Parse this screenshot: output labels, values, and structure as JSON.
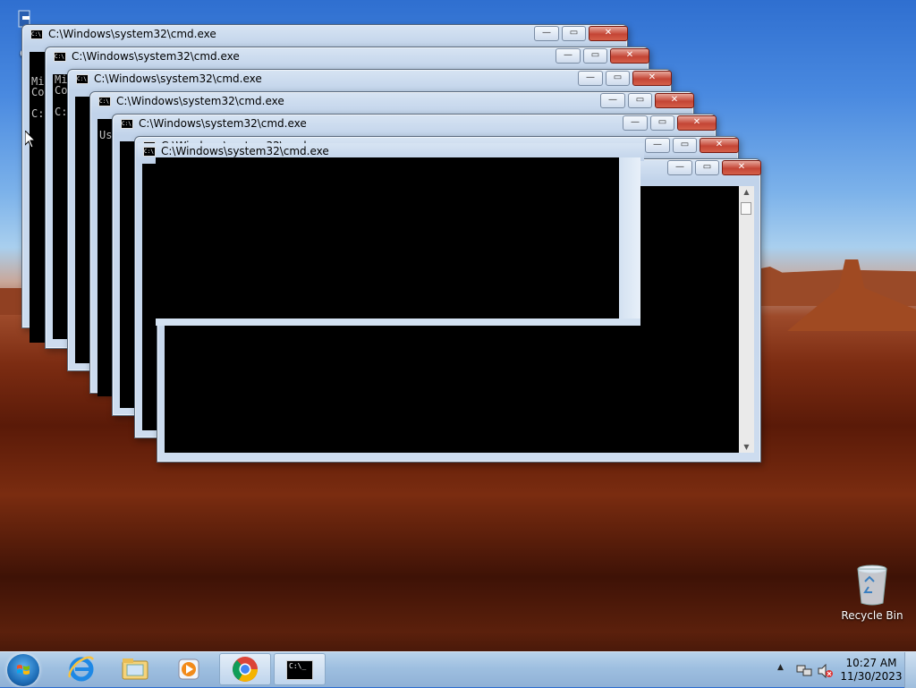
{
  "window_title": "C:\\Windows\\system32\\cmd.exe",
  "console_fragments": {
    "w1_lines": [
      "Mi",
      "Co",
      "",
      "C:"
    ],
    "w2_lines": [
      "Mi",
      "Co",
      "",
      "C:"
    ],
    "w3_lines": [
      "Us"
    ]
  },
  "desktop": {
    "computer_label": "Co",
    "recycle_bin_label": "Recycle Bin"
  },
  "taskbar": {
    "clock_time": "10:27 AM",
    "clock_date": "11/30/2023",
    "tray_chevron": "▲"
  },
  "colors": {
    "console_bg": "#000000",
    "close_button": "#c44535",
    "taskbar": "#9ebfe0"
  },
  "icons": [
    "start-orb-icon",
    "internet-explorer-icon",
    "file-explorer-icon",
    "media-player-icon",
    "chrome-icon",
    "cmd-icon",
    "recycle-bin-icon",
    "network-icon",
    "volume-muted-icon"
  ]
}
